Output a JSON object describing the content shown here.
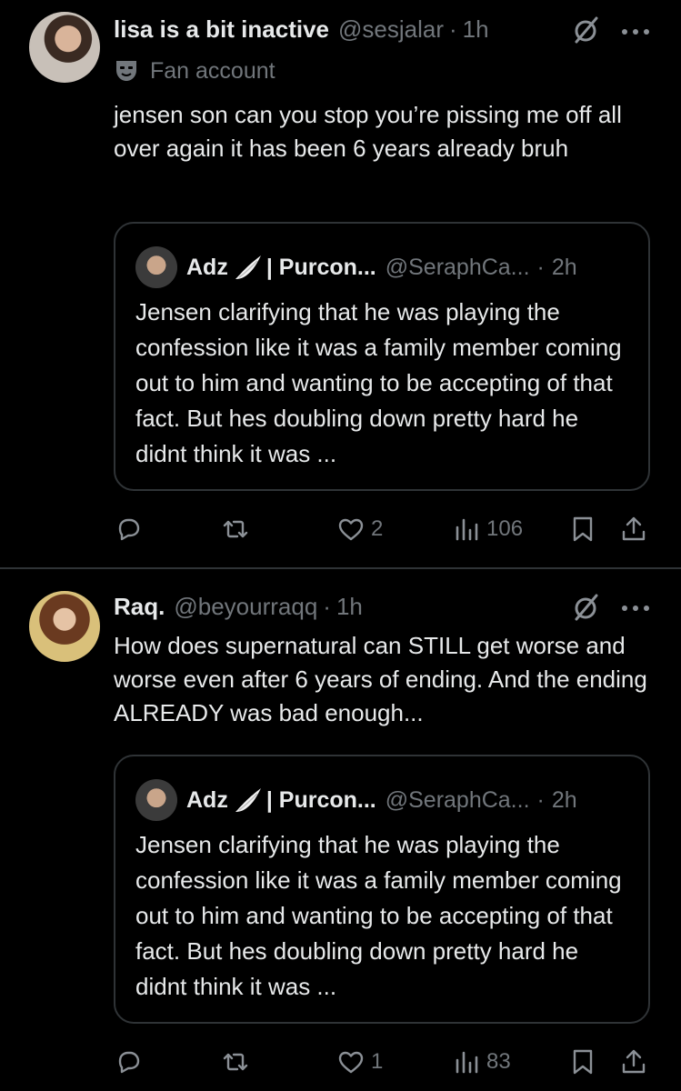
{
  "tweets": [
    {
      "author_name": "lisa is a bit inactive",
      "handle": "@sesjalar",
      "separator": "·",
      "time": "1h",
      "label": "Fan account",
      "text": "jensen son can you stop you’re pissing me off all over again it has been 6 years already bruh",
      "quote": {
        "author_name": "Adz",
        "name_suffix": "| Purcon...",
        "handle": "@SeraphCa...",
        "separator": "·",
        "time": "2h",
        "text": "Jensen clarifying that he was playing the confession like it was a family member coming out to him and wanting to be accepting of that fact. But hes doubling down pretty hard he didnt think it was ..."
      },
      "likes": "2",
      "views": "106"
    },
    {
      "author_name": "Raq.",
      "handle": "@beyourraqq",
      "separator": "·",
      "time": "1h",
      "text": "How does supernatural can STILL get worse and worse even after 6 years of ending. And the ending ALREADY was bad enough...",
      "quote": {
        "author_name": "Adz",
        "name_suffix": "| Purcon...",
        "handle": "@SeraphCa...",
        "separator": "·",
        "time": "2h",
        "text": "Jensen clarifying that he was playing the confession like it was a family member coming out to him and wanting to be accepting of that fact. But hes doubling down pretty hard he didnt think it was ..."
      },
      "likes": "1",
      "views": "83"
    }
  ],
  "icons": {
    "reply": "reply-icon",
    "retweet": "retweet-icon",
    "like": "heart-icon",
    "views": "views-icon",
    "bookmark": "bookmark-icon",
    "share": "share-icon",
    "grok": "grok-icon",
    "more": "more-icon",
    "fan": "mask-icon",
    "wing": "wing-icon"
  },
  "colors": {
    "background": "#000000",
    "text": "#e7e9ea",
    "secondary": "#71767b",
    "border": "#2f3336"
  }
}
